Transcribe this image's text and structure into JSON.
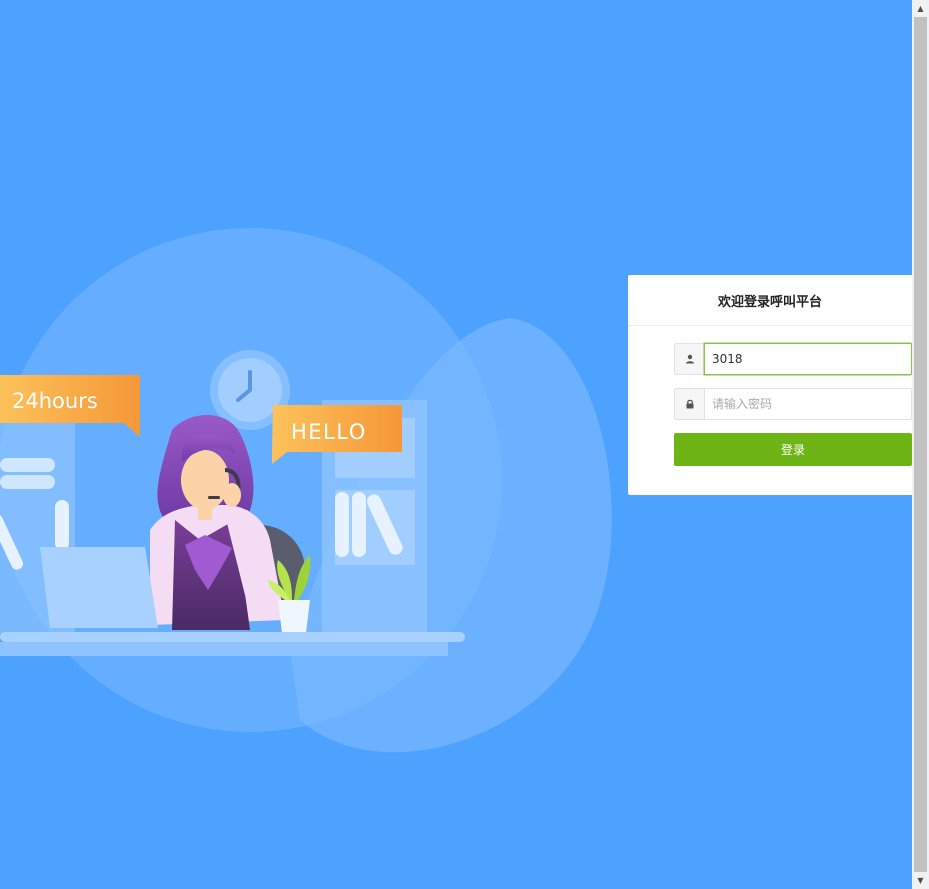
{
  "illustration": {
    "bubble_left": "24hours",
    "bubble_right": "HELLO"
  },
  "login": {
    "title": "欢迎登录呼叫平台",
    "username_value": "3018",
    "password_placeholder": "请输入密码",
    "submit_label": "登录",
    "user_icon": "user-icon",
    "lock_icon": "lock-icon"
  },
  "colors": {
    "background": "#4da1ff",
    "button": "#6fb415",
    "bubble": "#f7a240"
  }
}
